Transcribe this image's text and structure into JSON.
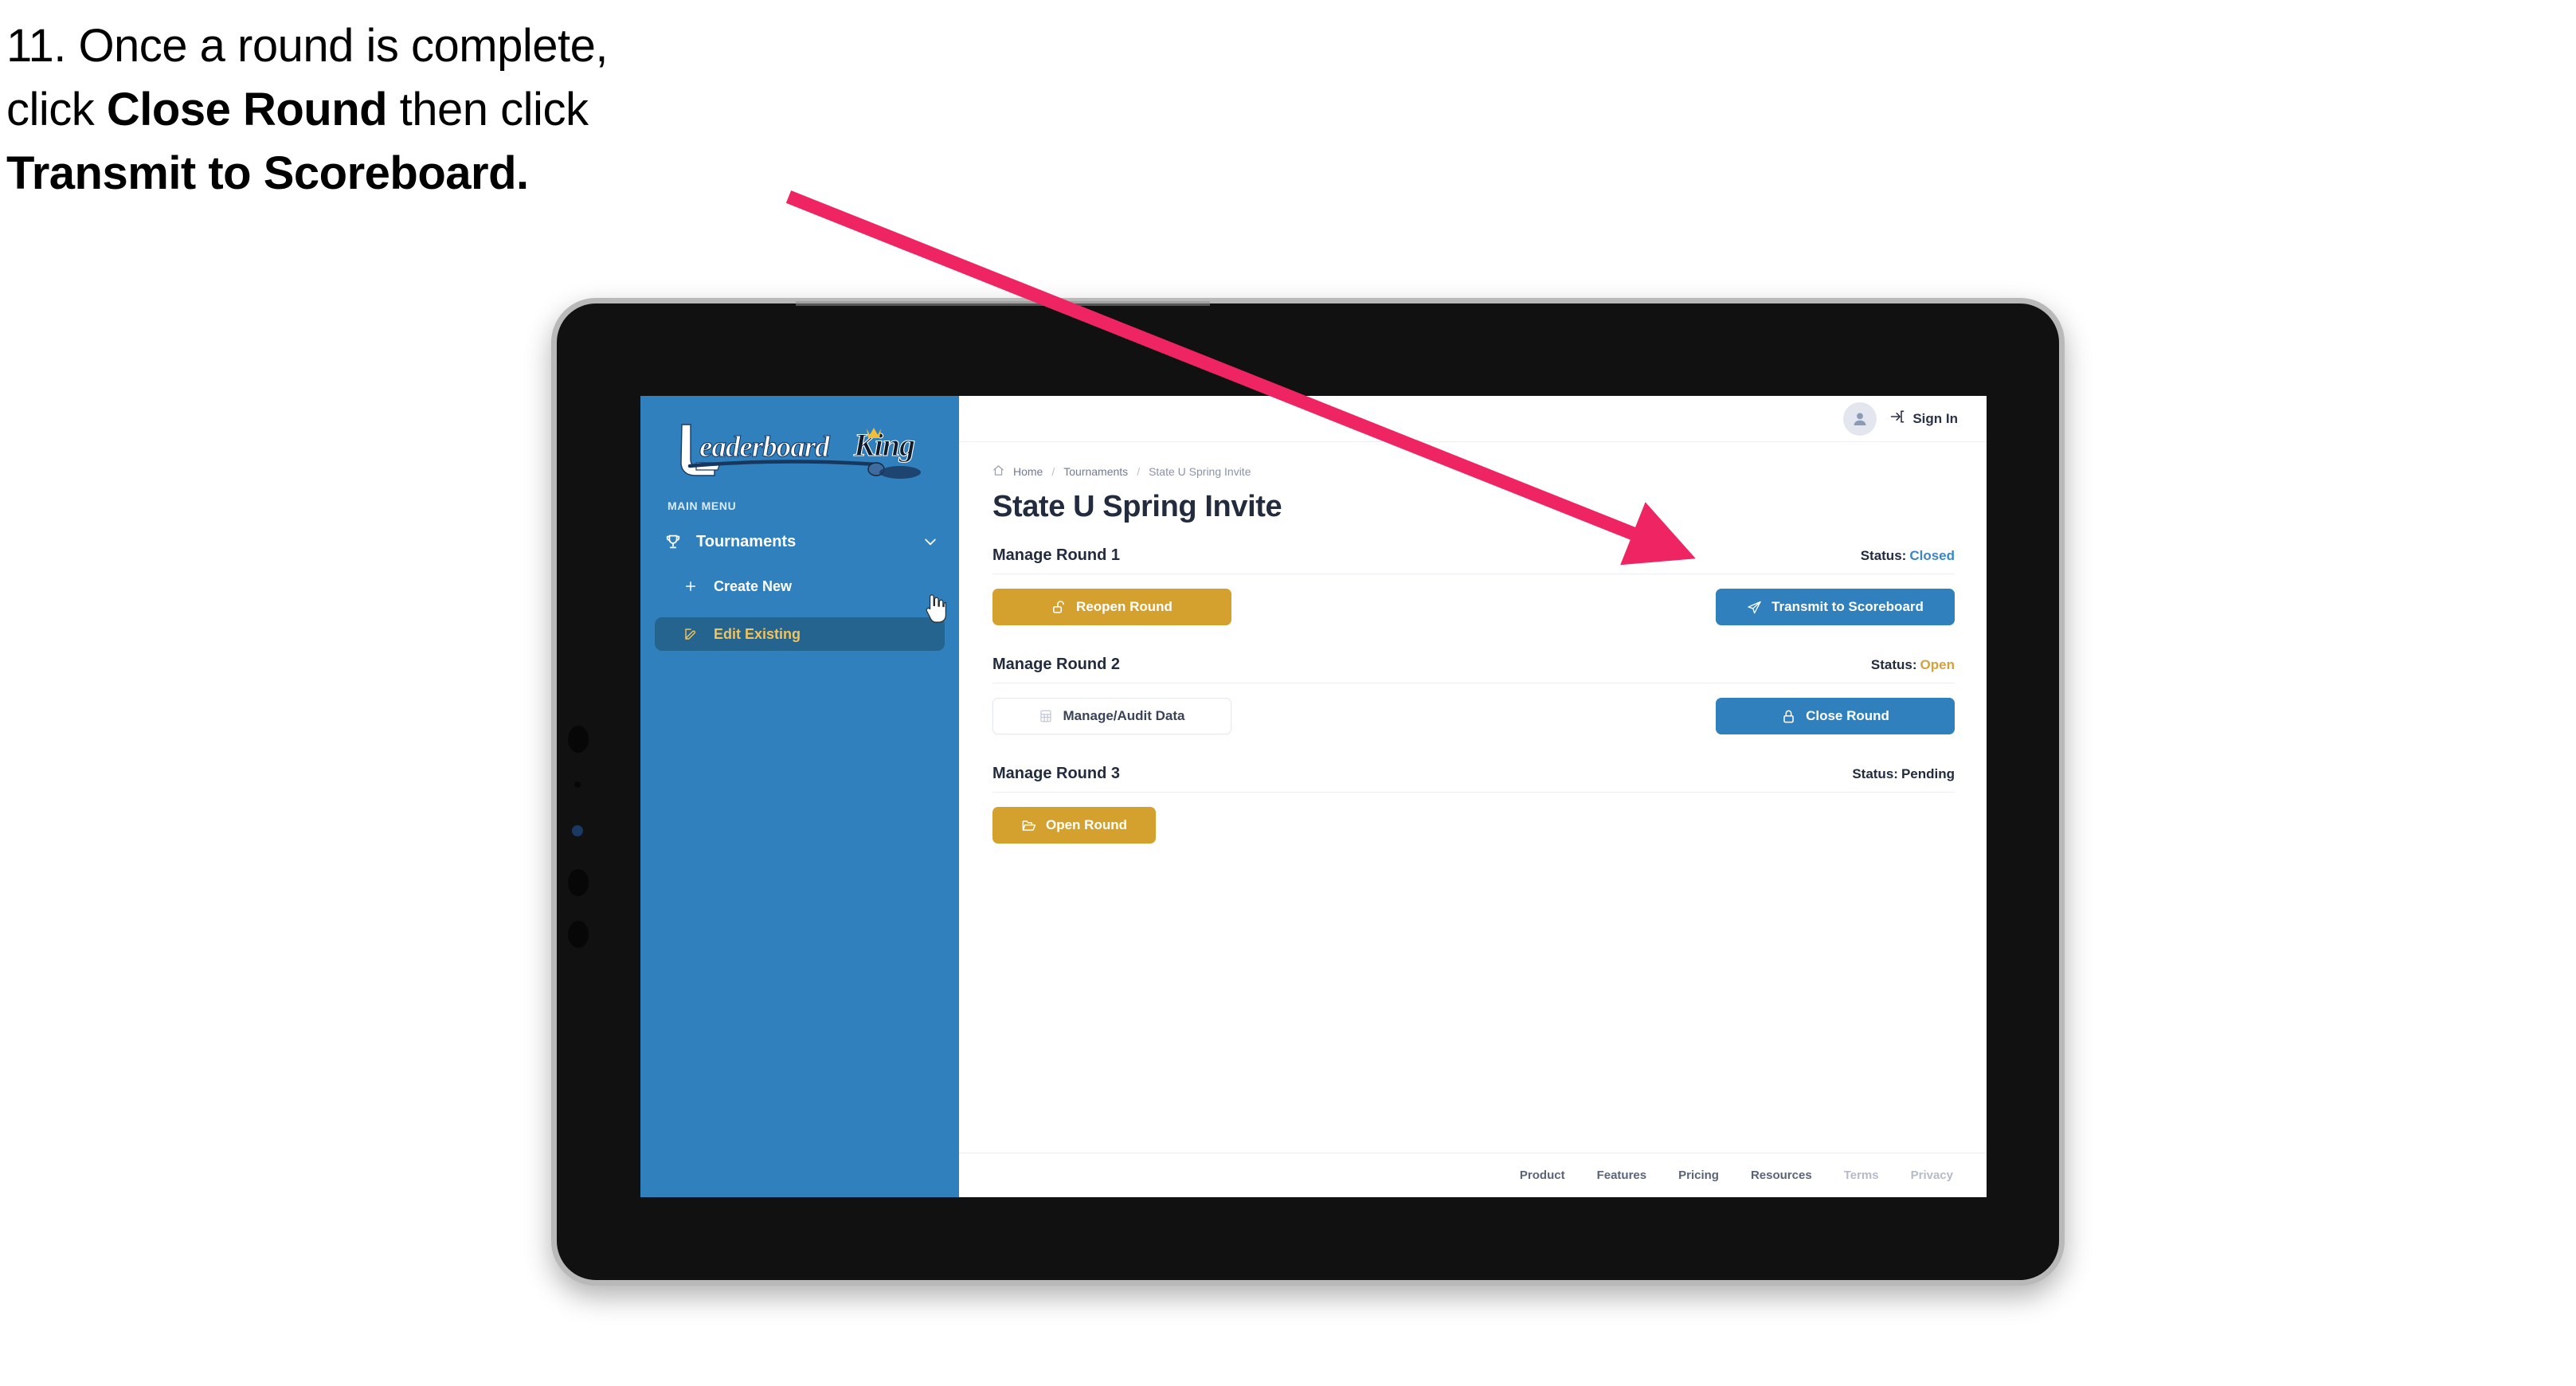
{
  "caption": {
    "line1_prefix": "11. Once a round is complete,",
    "line2_pre": "click ",
    "line2_bold": "Close Round",
    "line2_post": " then click",
    "line3_bold": "Transmit to Scoreboard."
  },
  "colors": {
    "accent_blue": "#2f80bd",
    "gold": "#d4a12e",
    "status_open": "#d6a13a",
    "status_closed": "#3a86c8",
    "arrow_pink": "#ee2463",
    "sidebar_active_bg": "#24648f",
    "sidebar_active_text": "#f0c35c"
  },
  "sidebar": {
    "logo_primary": "Leaderboard",
    "logo_secondary": "King",
    "menu_label": "MAIN MENU",
    "nav": {
      "top_label": "Tournaments",
      "top_icon": "trophy-icon",
      "chevron_icon": "chevron-down-icon"
    },
    "items": [
      {
        "label": "Create New",
        "icon": "plus-icon",
        "active": false
      },
      {
        "label": "Edit Existing",
        "icon": "edit-pencil-icon",
        "active": true
      }
    ],
    "cursor_icon": "pointing-hand-cursor"
  },
  "topbar": {
    "avatar_icon": "user-avatar-icon",
    "signin_icon": "login-arrow-icon",
    "signin_label": "Sign In"
  },
  "breadcrumb": {
    "home_icon": "home-icon",
    "items": [
      "Home",
      "Tournaments",
      "State U Spring Invite"
    ],
    "separator": "/"
  },
  "page": {
    "title": "State U Spring Invite"
  },
  "rounds": [
    {
      "name": "Manage Round 1",
      "status_label": "Status:",
      "status_value": "Closed",
      "status_color": "#3a86c8",
      "left_button": {
        "label": "Reopen Round",
        "icon": "unlock-icon",
        "style": "gold"
      },
      "right_button": {
        "label": "Transmit to Scoreboard",
        "icon": "paper-plane-icon",
        "style": "blue"
      }
    },
    {
      "name": "Manage Round 2",
      "status_label": "Status:",
      "status_value": "Open",
      "status_color": "#d6a13a",
      "left_button": {
        "label": "Manage/Audit Data",
        "icon": "table-grid-icon",
        "style": "ghost"
      },
      "right_button": {
        "label": "Close Round",
        "icon": "lock-icon",
        "style": "blue"
      }
    },
    {
      "name": "Manage Round 3",
      "status_label": "Status:",
      "status_value": "Pending",
      "status_color": "#232b3e",
      "left_button": {
        "label": "Open Round",
        "icon": "open-folder-icon",
        "style": "gold"
      },
      "right_button": null
    }
  ],
  "footer": {
    "links": [
      {
        "label": "Product",
        "muted": false
      },
      {
        "label": "Features",
        "muted": false
      },
      {
        "label": "Pricing",
        "muted": false
      },
      {
        "label": "Resources",
        "muted": false
      },
      {
        "label": "Terms",
        "muted": true
      },
      {
        "label": "Privacy",
        "muted": true
      }
    ]
  }
}
